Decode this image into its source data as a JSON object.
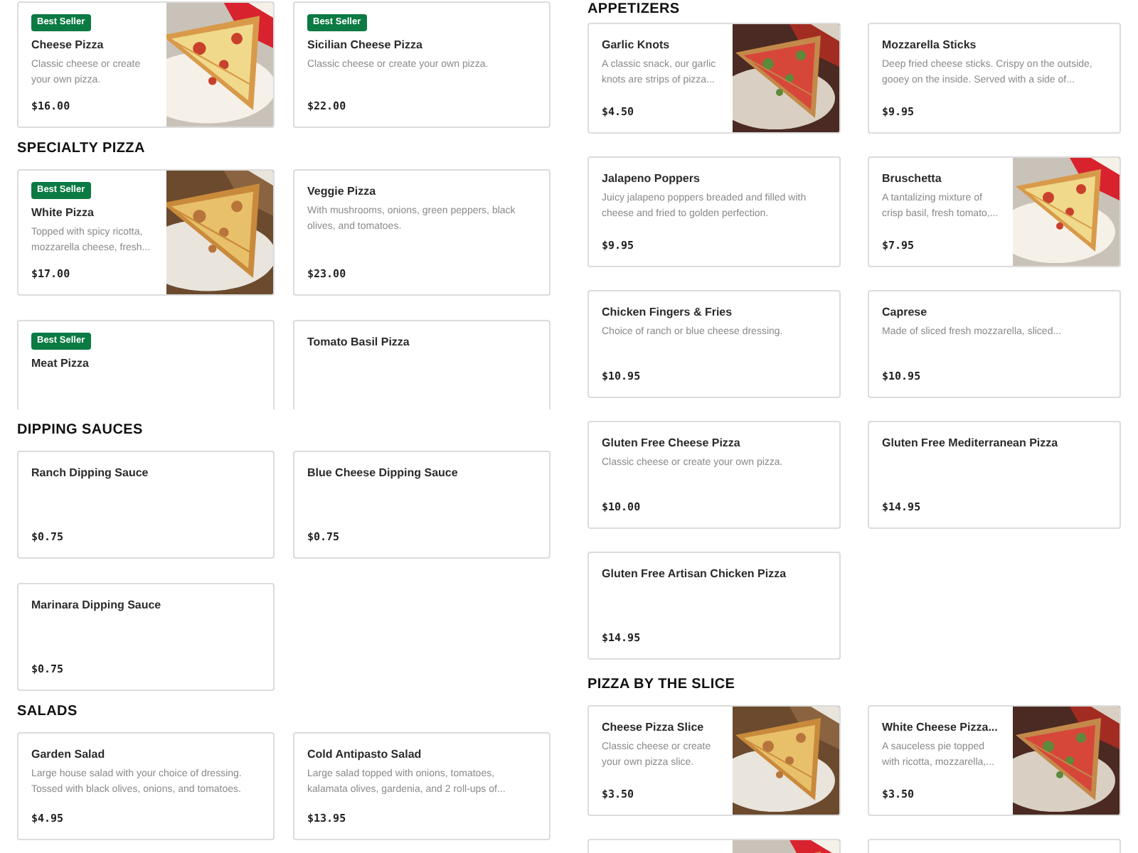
{
  "columns": [
    {
      "sections": [
        {
          "items": [
            {
              "badge": "Best Seller",
              "title": "Cheese Pizza",
              "description": "Classic cheese or create your own pizza.",
              "price": "$16.00",
              "image": true
            },
            {
              "badge": "Best Seller",
              "title": "Sicilian Cheese Pizza",
              "description": "Classic cheese or create your own pizza.",
              "price": "$22.00",
              "image": false
            }
          ]
        },
        {
          "heading": "SPECIALTY PIZZA",
          "items": [
            {
              "badge": "Best Seller",
              "title": "White Pizza",
              "description": "Topped with spicy ricotta, mozzarella cheese, fresh...",
              "price": "$17.00",
              "image": true
            },
            {
              "title": "Veggie Pizza",
              "description": "With mushrooms, onions, green peppers, black olives, and tomatoes.",
              "price": "$23.00",
              "image": false
            },
            {
              "badge": "Best Seller",
              "title": "Meat Pizza",
              "image": false
            },
            {
              "title": "Tomato Basil Pizza",
              "image": false
            }
          ]
        },
        {
          "heading": "DIPPING SAUCES",
          "items": [
            {
              "title": "Ranch Dipping Sauce",
              "price": "$0.75",
              "image": false
            },
            {
              "title": "Blue Cheese Dipping Sauce",
              "price": "$0.75",
              "image": false
            },
            {
              "title": "Marinara Dipping Sauce",
              "price": "$0.75",
              "image": false
            }
          ]
        },
        {
          "heading": "SALADS",
          "items": [
            {
              "title": "Garden Salad",
              "description": "Large house salad with your choice of dressing. Tossed with black olives, onions, and tomatoes.",
              "price": "$4.95",
              "image": false
            },
            {
              "title": "Cold Antipasto Salad",
              "description": "Large salad topped with onions, tomatoes, kalamata olives, gardenia, and 2 roll-ups of...",
              "price": "$13.95",
              "image": false
            }
          ]
        }
      ]
    },
    {
      "sections": [
        {
          "heading": "APPETIZERS",
          "items": [
            {
              "title": "Garlic Knots",
              "description": "A classic snack, our garlic knots are strips of pizza...",
              "price": "$4.50",
              "image": true
            },
            {
              "title": "Mozzarella Sticks",
              "description": "Deep fried cheese sticks. Crispy on the outside, gooey on the inside. Served with a side of...",
              "price": "$9.95",
              "image": false
            },
            {
              "title": "Jalapeno Poppers",
              "description": "Juicy jalapeno poppers breaded and filled with cheese and fried to golden perfection.",
              "price": "$9.95",
              "image": false
            },
            {
              "title": "Bruschetta",
              "description": "A tantalizing mixture of crisp basil, fresh tomato,...",
              "price": "$7.95",
              "image": true
            },
            {
              "title": "Chicken Fingers & Fries",
              "description": "Choice of ranch or blue cheese dressing.",
              "price": "$10.95",
              "image": false
            },
            {
              "title": "Caprese",
              "description": "Made of sliced fresh mozzarella, sliced...",
              "price": "$10.95",
              "image": false
            },
            {
              "title": "Gluten Free Cheese Pizza",
              "description": "Classic cheese or create your own pizza.",
              "price": "$10.00",
              "image": false
            },
            {
              "title": "Gluten Free Mediterranean Pizza",
              "price": "$14.95",
              "image": false
            },
            {
              "title": "Gluten Free Artisan Chicken Pizza",
              "price": "$14.95",
              "image": false
            }
          ]
        },
        {
          "heading": "PIZZA BY THE SLICE",
          "items": [
            {
              "title": "Cheese Pizza Slice",
              "description": "Classic cheese or create your own pizza slice.",
              "price": "$3.50",
              "image": true
            },
            {
              "title": "White Cheese Pizza...",
              "description": "A sauceless pie topped with ricotta, mozzarella,...",
              "price": "$3.50",
              "image": true
            },
            {
              "image": true
            },
            {
              "image": false
            }
          ]
        }
      ]
    }
  ]
}
